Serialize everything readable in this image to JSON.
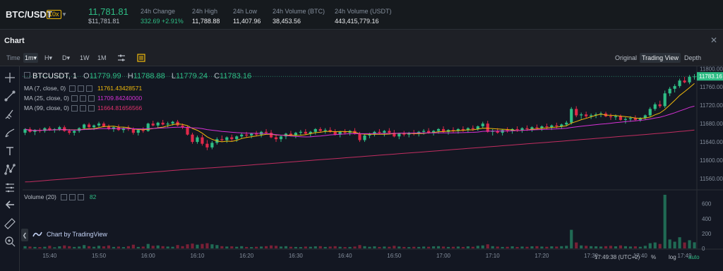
{
  "header": {
    "pair": "BTC/USDT",
    "leverage": "10x",
    "last_price": "11,781.81",
    "last_price_usd": "$11,781.81",
    "stats": [
      {
        "label": "24h Change",
        "value": "332.69 +2.91%"
      },
      {
        "label": "24h High",
        "value": "11,788.88"
      },
      {
        "label": "24h Low",
        "value": "11,407.96"
      },
      {
        "label": "24h Volume (BTC)",
        "value": "38,453.56"
      },
      {
        "label": "24h Volume (USDT)",
        "value": "443,415,779.16"
      }
    ]
  },
  "panel": {
    "title": "Chart",
    "time_label": "Time",
    "intervals": [
      "1m",
      "H",
      "D",
      "1W",
      "1M"
    ],
    "active_interval": "1m",
    "views": [
      "Original",
      "Trading View",
      "Depth"
    ],
    "active_view": "Trading View"
  },
  "legend": {
    "symbol": "BTCUSDT, 1",
    "ohlc": {
      "o_label": "O",
      "o": "11779.99",
      "h_label": "H",
      "h": "11788.88",
      "l_label": "L",
      "l": "11779.24",
      "c_label": "C",
      "c": "11783.16"
    },
    "ma": [
      {
        "label": "MA (7, close, 0)",
        "value": "11761.43428571",
        "color": "#f0b90b"
      },
      {
        "label": "MA (25, close, 0)",
        "value": "11709.84240000",
        "color": "#d631d6"
      },
      {
        "label": "MA (99, close, 0)",
        "value": "11664.81656566",
        "color": "#e0316b"
      }
    ],
    "volume_label": "Volume (20)",
    "volume_value": "82"
  },
  "brand": "Chart by TradingView",
  "footer": {
    "clock": "17:49:38 (UTC+2)",
    "percent": "%",
    "log": "log",
    "auto": "auto"
  },
  "colors": {
    "up": "#2ebd85",
    "down": "#e0294a",
    "ma7": "#f0b90b",
    "ma25": "#d631d6",
    "ma99": "#e0316b",
    "accent": "#f0b90b"
  },
  "icons": [
    "crosshair-icon",
    "trendline-icon",
    "brush-icon",
    "pen-icon",
    "text-icon",
    "pattern-icon",
    "fib-icon",
    "back-arrow-icon",
    "ruler-icon",
    "zoom-icon",
    "settings-sliders-icon",
    "indicator-icon",
    "close-icon",
    "chevron-down-icon",
    "tradingview-logo-icon"
  ],
  "chart_data": {
    "type": "candlestick",
    "price_axis_ticks": [
      "11800.00",
      "11760.00",
      "11720.00",
      "11680.00",
      "11640.00",
      "11600.00",
      "11560.00"
    ],
    "price_ylim": [
      11540,
      11805
    ],
    "last_price_label": "11783.16",
    "volume_axis_ticks": [
      "600",
      "400",
      "200",
      "0"
    ],
    "volume_ylim": [
      0,
      720
    ],
    "time_ticks": [
      "15:40",
      "15:50",
      "16:00",
      "16:10",
      "16:20",
      "16:30",
      "16:40",
      "16:50",
      "17:00",
      "17:10",
      "17:20",
      "17:30",
      "17:40",
      "17:49"
    ],
    "start_time": "15:35",
    "candles": [
      [
        11660,
        11670,
        11655,
        11668,
        30
      ],
      [
        11668,
        11672,
        11660,
        11662,
        25
      ],
      [
        11662,
        11668,
        11655,
        11666,
        20
      ],
      [
        11666,
        11670,
        11660,
        11664,
        18
      ],
      [
        11664,
        11672,
        11660,
        11670,
        22
      ],
      [
        11670,
        11674,
        11664,
        11666,
        35
      ],
      [
        11666,
        11670,
        11660,
        11668,
        15
      ],
      [
        11668,
        11675,
        11664,
        11672,
        28
      ],
      [
        11672,
        11676,
        11662,
        11664,
        40
      ],
      [
        11664,
        11668,
        11656,
        11660,
        30
      ],
      [
        11660,
        11666,
        11654,
        11664,
        20
      ],
      [
        11664,
        11672,
        11660,
        11670,
        25
      ],
      [
        11670,
        11680,
        11666,
        11678,
        45
      ],
      [
        11678,
        11682,
        11670,
        11672,
        30
      ],
      [
        11672,
        11678,
        11666,
        11676,
        22
      ],
      [
        11676,
        11684,
        11672,
        11680,
        35
      ],
      [
        11680,
        11684,
        11672,
        11674,
        28
      ],
      [
        11674,
        11678,
        11666,
        11668,
        40
      ],
      [
        11668,
        11674,
        11662,
        11672,
        20
      ],
      [
        11672,
        11678,
        11664,
        11666,
        25
      ],
      [
        11666,
        11672,
        11660,
        11670,
        18
      ],
      [
        11670,
        11676,
        11664,
        11668,
        30
      ],
      [
        11668,
        11672,
        11656,
        11660,
        50
      ],
      [
        11660,
        11668,
        11654,
        11666,
        20
      ],
      [
        11666,
        11672,
        11660,
        11664,
        25
      ],
      [
        11664,
        11682,
        11662,
        11680,
        60
      ],
      [
        11680,
        11686,
        11674,
        11676,
        35
      ],
      [
        11676,
        11684,
        11670,
        11682,
        40
      ],
      [
        11682,
        11688,
        11676,
        11678,
        30
      ],
      [
        11678,
        11684,
        11672,
        11680,
        25
      ],
      [
        11680,
        11686,
        11676,
        11684,
        22
      ],
      [
        11684,
        11688,
        11674,
        11676,
        45
      ],
      [
        11676,
        11680,
        11668,
        11672,
        30
      ],
      [
        11672,
        11676,
        11654,
        11656,
        55
      ],
      [
        11656,
        11660,
        11636,
        11640,
        65
      ],
      [
        11640,
        11654,
        11636,
        11650,
        50
      ],
      [
        11650,
        11656,
        11632,
        11636,
        60
      ],
      [
        11636,
        11644,
        11622,
        11628,
        70
      ],
      [
        11628,
        11642,
        11624,
        11638,
        55
      ],
      [
        11638,
        11650,
        11634,
        11646,
        45
      ],
      [
        11646,
        11654,
        11640,
        11644,
        30
      ],
      [
        11644,
        11652,
        11638,
        11650,
        25
      ],
      [
        11650,
        11656,
        11642,
        11646,
        28
      ],
      [
        11646,
        11654,
        11640,
        11652,
        22
      ],
      [
        11652,
        11660,
        11648,
        11656,
        30
      ],
      [
        11656,
        11662,
        11650,
        11654,
        20
      ],
      [
        11654,
        11660,
        11648,
        11658,
        18
      ],
      [
        11658,
        11664,
        11652,
        11656,
        22
      ],
      [
        11656,
        11664,
        11650,
        11662,
        25
      ],
      [
        11662,
        11668,
        11656,
        11660,
        30
      ],
      [
        11660,
        11666,
        11648,
        11650,
        40
      ],
      [
        11650,
        11656,
        11640,
        11646,
        35
      ],
      [
        11646,
        11654,
        11640,
        11652,
        25
      ],
      [
        11652,
        11660,
        11646,
        11658,
        30
      ],
      [
        11658,
        11664,
        11652,
        11654,
        22
      ],
      [
        11654,
        11662,
        11648,
        11660,
        20
      ],
      [
        11660,
        11666,
        11654,
        11662,
        18
      ],
      [
        11662,
        11668,
        11656,
        11658,
        25
      ],
      [
        11658,
        11664,
        11652,
        11662,
        22
      ],
      [
        11662,
        11670,
        11656,
        11668,
        28
      ],
      [
        11668,
        11672,
        11660,
        11664,
        30
      ],
      [
        11664,
        11670,
        11658,
        11666,
        20
      ],
      [
        11666,
        11672,
        11660,
        11662,
        25
      ],
      [
        11662,
        11668,
        11654,
        11656,
        30
      ],
      [
        11656,
        11664,
        11650,
        11662,
        22
      ],
      [
        11662,
        11668,
        11656,
        11660,
        18
      ],
      [
        11660,
        11666,
        11654,
        11664,
        20
      ],
      [
        11664,
        11670,
        11656,
        11658,
        25
      ],
      [
        11658,
        11662,
        11640,
        11644,
        45
      ],
      [
        11644,
        11656,
        11640,
        11654,
        30
      ],
      [
        11654,
        11660,
        11648,
        11656,
        22
      ],
      [
        11656,
        11664,
        11652,
        11662,
        28
      ],
      [
        11662,
        11668,
        11656,
        11660,
        20
      ],
      [
        11660,
        11666,
        11652,
        11664,
        25
      ],
      [
        11664,
        11670,
        11658,
        11660,
        22
      ],
      [
        11660,
        11666,
        11650,
        11652,
        35
      ],
      [
        11652,
        11660,
        11646,
        11658,
        25
      ],
      [
        11658,
        11664,
        11652,
        11656,
        20
      ],
      [
        11656,
        11662,
        11650,
        11660,
        18
      ],
      [
        11660,
        11666,
        11654,
        11658,
        22
      ],
      [
        11658,
        11664,
        11652,
        11662,
        20
      ],
      [
        11662,
        11668,
        11656,
        11664,
        25
      ],
      [
        11664,
        11670,
        11658,
        11660,
        22
      ],
      [
        11660,
        11666,
        11654,
        11664,
        28
      ],
      [
        11664,
        11670,
        11658,
        11668,
        30
      ],
      [
        11668,
        11674,
        11660,
        11662,
        25
      ],
      [
        11662,
        11668,
        11656,
        11666,
        20
      ],
      [
        11666,
        11672,
        11660,
        11664,
        22
      ],
      [
        11664,
        11670,
        11658,
        11668,
        25
      ],
      [
        11668,
        11674,
        11662,
        11666,
        20
      ],
      [
        11666,
        11672,
        11660,
        11670,
        28
      ],
      [
        11670,
        11676,
        11664,
        11668,
        22
      ],
      [
        11668,
        11676,
        11664,
        11674,
        35
      ],
      [
        11674,
        11684,
        11670,
        11680,
        40
      ],
      [
        11680,
        11686,
        11660,
        11662,
        55
      ],
      [
        11662,
        11668,
        11654,
        11664,
        30
      ],
      [
        11664,
        11670,
        11658,
        11660,
        25
      ],
      [
        11660,
        11668,
        11654,
        11666,
        20
      ],
      [
        11666,
        11672,
        11660,
        11664,
        22
      ],
      [
        11664,
        11670,
        11658,
        11668,
        28
      ],
      [
        11668,
        11674,
        11662,
        11666,
        20
      ],
      [
        11666,
        11672,
        11660,
        11670,
        25
      ],
      [
        11670,
        11676,
        11664,
        11668,
        22
      ],
      [
        11668,
        11674,
        11662,
        11672,
        28
      ],
      [
        11672,
        11678,
        11666,
        11670,
        30
      ],
      [
        11670,
        11676,
        11664,
        11674,
        25
      ],
      [
        11674,
        11680,
        11668,
        11672,
        22
      ],
      [
        11672,
        11678,
        11666,
        11676,
        28
      ],
      [
        11676,
        11682,
        11670,
        11674,
        25
      ],
      [
        11674,
        11680,
        11668,
        11678,
        30
      ],
      [
        11678,
        11686,
        11674,
        11682,
        35
      ],
      [
        11682,
        11716,
        11678,
        11712,
        250
      ],
      [
        11712,
        11718,
        11694,
        11698,
        80
      ],
      [
        11698,
        11704,
        11690,
        11700,
        40
      ],
      [
        11700,
        11706,
        11692,
        11696,
        35
      ],
      [
        11696,
        11702,
        11690,
        11698,
        30
      ],
      [
        11698,
        11704,
        11692,
        11700,
        28
      ],
      [
        11700,
        11706,
        11694,
        11702,
        25
      ],
      [
        11702,
        11706,
        11694,
        11696,
        30
      ],
      [
        11696,
        11702,
        11688,
        11694,
        35
      ],
      [
        11694,
        11700,
        11688,
        11696,
        28
      ],
      [
        11696,
        11700,
        11686,
        11688,
        40
      ],
      [
        11688,
        11694,
        11680,
        11690,
        30
      ],
      [
        11690,
        11696,
        11684,
        11692,
        25
      ],
      [
        11692,
        11698,
        11686,
        11688,
        28
      ],
      [
        11688,
        11694,
        11684,
        11692,
        22
      ],
      [
        11692,
        11700,
        11688,
        11698,
        35
      ],
      [
        11698,
        11716,
        11694,
        11712,
        70
      ],
      [
        11712,
        11726,
        11708,
        11722,
        80
      ],
      [
        11722,
        11730,
        11714,
        11718,
        60
      ],
      [
        11718,
        11752,
        11714,
        11746,
        720
      ],
      [
        11746,
        11760,
        11740,
        11756,
        120
      ],
      [
        11756,
        11766,
        11748,
        11762,
        90
      ],
      [
        11762,
        11778,
        11758,
        11774,
        150
      ],
      [
        11774,
        11782,
        11768,
        11770,
        80
      ],
      [
        11770,
        11786,
        11766,
        11782,
        110
      ],
      [
        11782,
        11788,
        11776,
        11783,
        82
      ]
    ]
  }
}
